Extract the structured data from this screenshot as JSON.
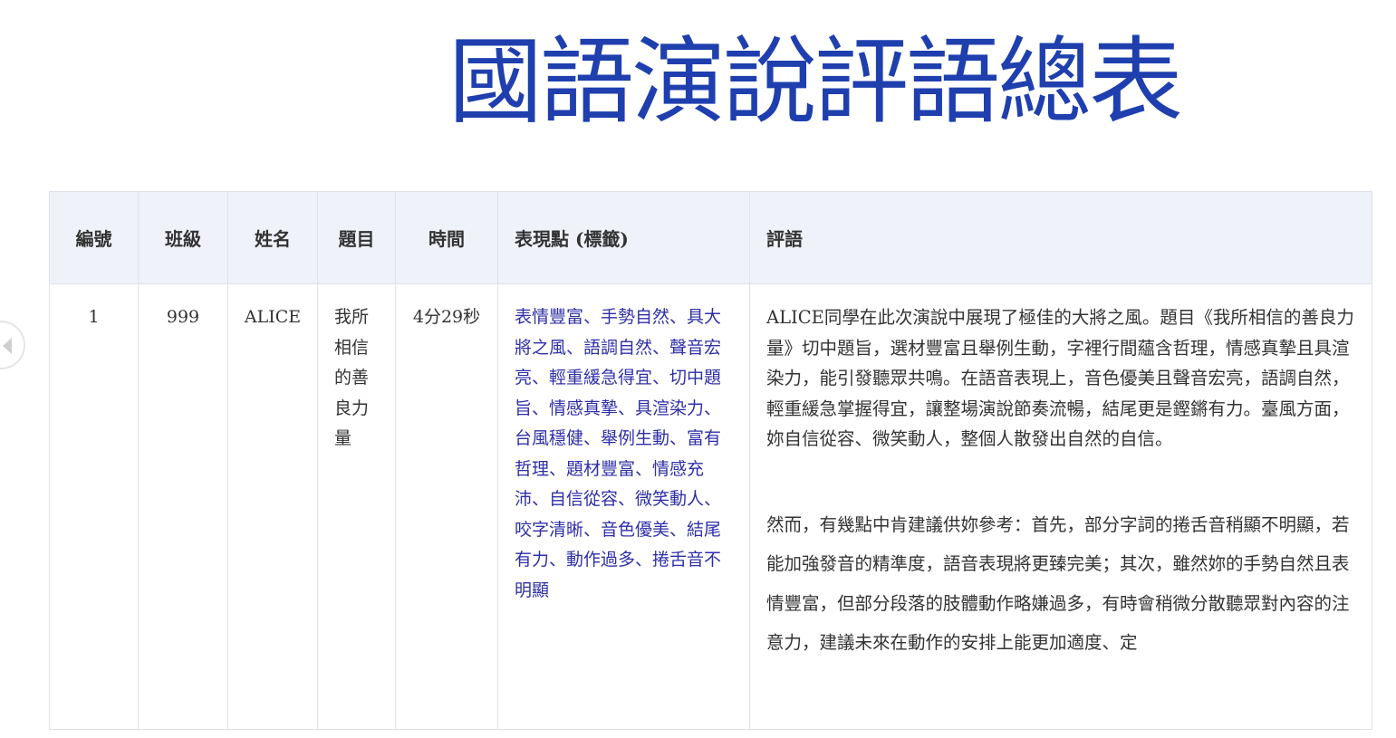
{
  "title": "國語演說評語總表",
  "table": {
    "headers": {
      "number": "編號",
      "class": "班級",
      "name": "姓名",
      "topic": "題目",
      "time": "時間",
      "tags": "表現點 (標籤)",
      "comment": "評語"
    },
    "rows": [
      {
        "number": "1",
        "class": "999",
        "name": "ALICE",
        "topic": "我所相信的善良力量",
        "time": "4分29秒",
        "tags": "表情豐富、手勢自然、具大將之風、語調自然、聲音宏亮、輕重緩急得宜、切中題旨、情感真摯、具渲染力、台風穩健、舉例生動、富有哲理、題材豐富、情感充沛、自信從容、微笑動人、咬字清晰、音色優美、結尾有力、動作過多、捲舌音不明顯",
        "comment_p1": "ALICE同學在此次演說中展現了極佳的大將之風。題目《我所相信的善良力量》切中題旨，選材豐富且舉例生動，字裡行間蘊含哲理，情感真摯且具渲染力，能引發聽眾共鳴。在語音表現上，音色優美且聲音宏亮，語調自然，輕重緩急掌握得宜，讓整場演說節奏流暢，結尾更是鏗鏘有力。臺風方面，妳自信從容、微笑動人，整個人散發出自然的自信。",
        "comment_p2": "然而，有幾點中肯建議供妳參考：首先，部分字詞的捲舌音稍顯不明顯，若能加強發音的精準度，語音表現將更臻完美；其次，雖然妳的手勢自然且表情豐富，但部分段落的肢體動作略嫌過多，有時會稍微分散聽眾對內容的注意力，建議未來在動作的安排上能更加適度、定"
      }
    ]
  },
  "icons": {
    "prev": "chevron-left-icon"
  }
}
